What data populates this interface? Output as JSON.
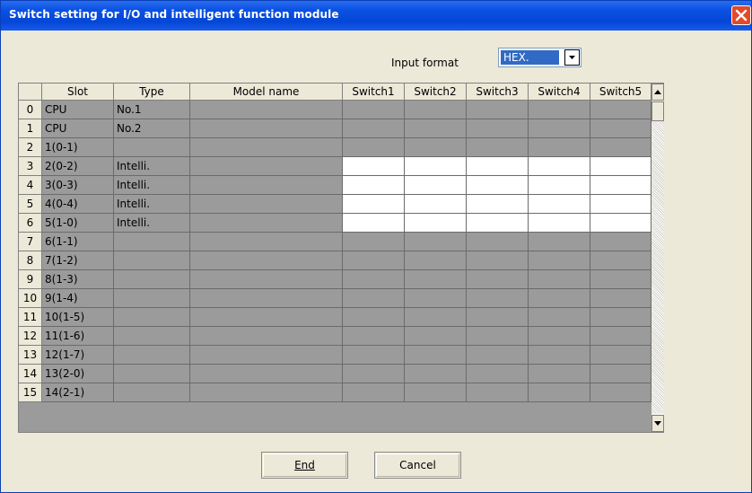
{
  "window": {
    "title": "Switch setting for I/O and intelligent function module"
  },
  "input_format": {
    "label": "Input format",
    "value": "HEX."
  },
  "grid": {
    "headers": [
      "Slot",
      "Type",
      "Model name",
      "Switch1",
      "Switch2",
      "Switch3",
      "Switch4",
      "Switch5"
    ],
    "rows": [
      {
        "index": "0",
        "slot": "CPU",
        "type": "No.1",
        "model": ""
      },
      {
        "index": "1",
        "slot": "CPU",
        "type": "No.2",
        "model": ""
      },
      {
        "index": "2",
        "slot": "1(0-1)",
        "type": "",
        "model": ""
      },
      {
        "index": "3",
        "slot": "2(0-2)",
        "type": "Intelli.",
        "model": ""
      },
      {
        "index": "4",
        "slot": "3(0-3)",
        "type": "Intelli.",
        "model": ""
      },
      {
        "index": "5",
        "slot": "4(0-4)",
        "type": "Intelli.",
        "model": ""
      },
      {
        "index": "6",
        "slot": "5(1-0)",
        "type": "Intelli.",
        "model": ""
      },
      {
        "index": "7",
        "slot": "6(1-1)",
        "type": "",
        "model": ""
      },
      {
        "index": "8",
        "slot": "7(1-2)",
        "type": "",
        "model": ""
      },
      {
        "index": "9",
        "slot": "8(1-3)",
        "type": "",
        "model": ""
      },
      {
        "index": "10",
        "slot": "9(1-4)",
        "type": "",
        "model": ""
      },
      {
        "index": "11",
        "slot": "10(1-5)",
        "type": "",
        "model": ""
      },
      {
        "index": "12",
        "slot": "11(1-6)",
        "type": "",
        "model": ""
      },
      {
        "index": "13",
        "slot": "12(1-7)",
        "type": "",
        "model": ""
      },
      {
        "index": "14",
        "slot": "13(2-0)",
        "type": "",
        "model": ""
      },
      {
        "index": "15",
        "slot": "14(2-1)",
        "type": "",
        "model": ""
      }
    ]
  },
  "buttons": {
    "end": "End",
    "cancel": "Cancel"
  },
  "colors": {
    "titlebar": "#0b52e3",
    "cell_gray": "#9b9b9b",
    "cell_white": "#ffffff",
    "close": "#e24a2b"
  }
}
